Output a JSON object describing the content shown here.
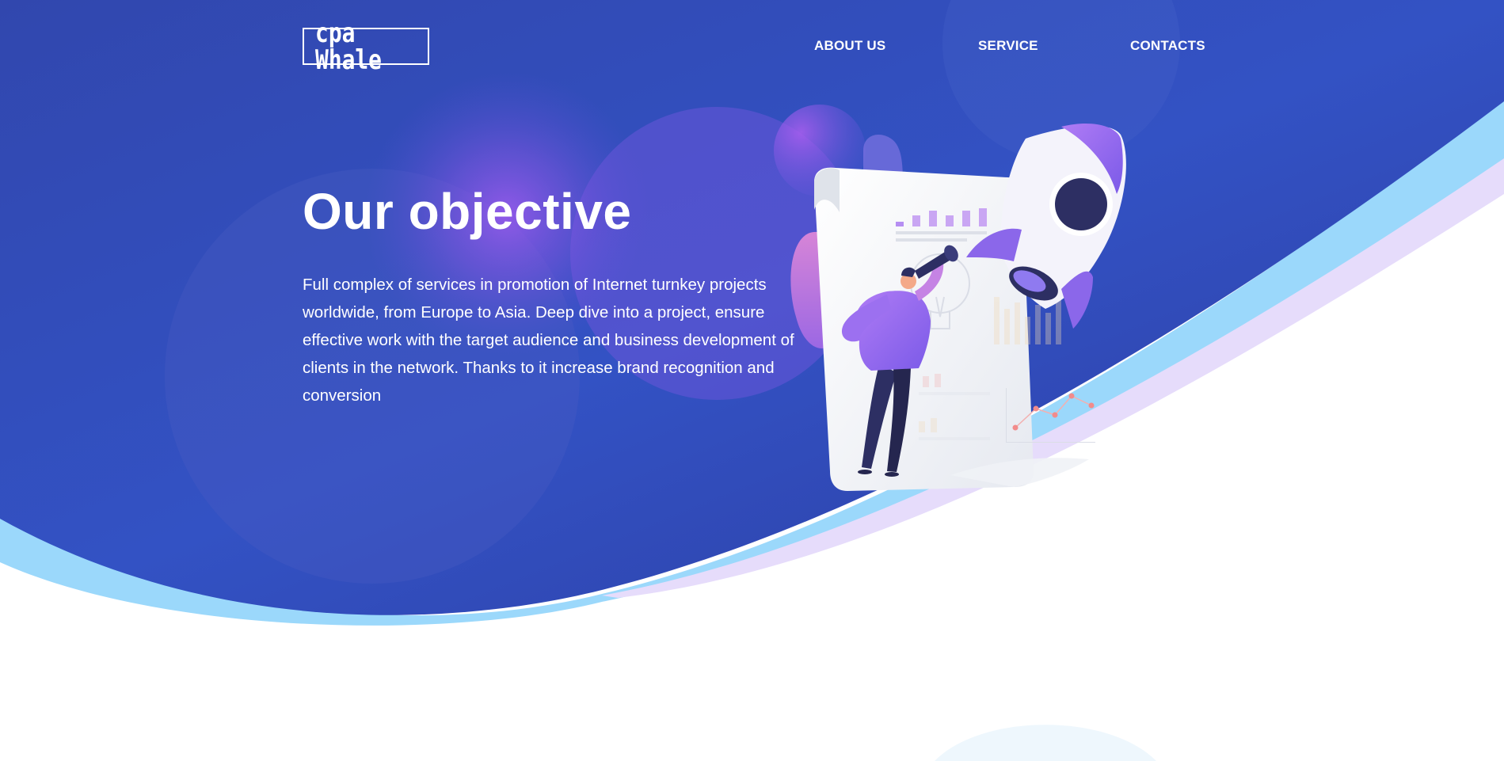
{
  "logo": {
    "text": "cpa Whale"
  },
  "nav": {
    "items": [
      {
        "label": "ABOUT US"
      },
      {
        "label": "SERVICE"
      },
      {
        "label": "CONTACTS"
      }
    ]
  },
  "hero": {
    "title": "Our objective",
    "description": "Full complex of services in promotion of Internet turnkey projects worldwide, from Europe to Asia. Deep dive into a project, ensure effective work with the target audience and business development of clients in the network. Thanks to it increase brand recognition and conversion"
  },
  "colors": {
    "background_blue": "#3044a8",
    "accent_purple": "#9b5cf0",
    "wave_light_blue": "#9bd8fb",
    "wave_lavender": "#e6dcfb",
    "text_white": "#ffffff"
  },
  "illustration": {
    "icons": [
      "rocket-icon",
      "telescope-icon",
      "lightbulb-icon",
      "bar-chart-icon",
      "line-chart-icon"
    ]
  }
}
